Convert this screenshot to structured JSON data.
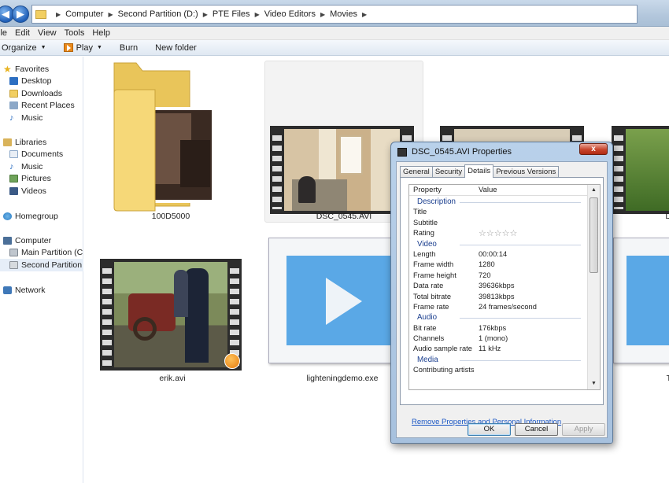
{
  "address": {
    "crumbs": [
      "Computer",
      "Second Partition (D:)",
      "PTE Files",
      "Video Editors",
      "Movies"
    ]
  },
  "menu": [
    "ile",
    "Edit",
    "View",
    "Tools",
    "Help"
  ],
  "toolbar": {
    "organize": "Organize",
    "play": "Play",
    "burn": "Burn",
    "new_folder": "New folder"
  },
  "sidebar": {
    "favorites": "Favorites",
    "fav_items": [
      "Desktop",
      "Downloads",
      "Recent Places",
      "Music"
    ],
    "libraries": "Libraries",
    "lib_items": [
      "Documents",
      "Music",
      "Pictures",
      "Videos"
    ],
    "homegroup": "Homegroup",
    "computer": "Computer",
    "comp_items": [
      "Main Partition (C:)",
      "Second Partition (D:)"
    ],
    "network": "Network"
  },
  "files": [
    {
      "name": "100D5000",
      "kind": "folder"
    },
    {
      "name": "DSC_0545.AVI",
      "kind": "video",
      "selected": true
    },
    {
      "name": "erik.avi",
      "kind": "video"
    },
    {
      "name": "lighteningdemo.exe",
      "kind": "exe"
    },
    {
      "name": "D",
      "kind": "video"
    },
    {
      "name": "T",
      "kind": "exe"
    }
  ],
  "dialog": {
    "title": "DSC_0545.AVI Properties",
    "close": "x",
    "tabs": [
      "General",
      "Security",
      "Details",
      "Previous Versions"
    ],
    "active_tab": "Details",
    "col_property": "Property",
    "col_value": "Value",
    "rows": [
      {
        "type": "section",
        "k": "Description"
      },
      {
        "type": "prop",
        "k": "Title",
        "v": ""
      },
      {
        "type": "prop",
        "k": "Subtitle",
        "v": ""
      },
      {
        "type": "rating",
        "k": "Rating",
        "v": "☆☆☆☆☆"
      },
      {
        "type": "section",
        "k": "Video"
      },
      {
        "type": "prop",
        "k": "Length",
        "v": "00:00:14"
      },
      {
        "type": "prop",
        "k": "Frame width",
        "v": "1280"
      },
      {
        "type": "prop",
        "k": "Frame height",
        "v": "720"
      },
      {
        "type": "prop",
        "k": "Data rate",
        "v": "39636kbps"
      },
      {
        "type": "prop",
        "k": "Total bitrate",
        "v": "39813kbps"
      },
      {
        "type": "prop",
        "k": "Frame rate",
        "v": "24 frames/second"
      },
      {
        "type": "section",
        "k": "Audio"
      },
      {
        "type": "prop",
        "k": "Bit rate",
        "v": "176kbps"
      },
      {
        "type": "prop",
        "k": "Channels",
        "v": "1 (mono)"
      },
      {
        "type": "prop",
        "k": "Audio sample rate",
        "v": "11 kHz"
      },
      {
        "type": "section",
        "k": "Media"
      },
      {
        "type": "prop",
        "k": "Contributing artists",
        "v": ""
      }
    ],
    "remove_link": "Remove Properties and Personal Information",
    "ok": "OK",
    "cancel": "Cancel",
    "apply": "Apply"
  },
  "colors": {
    "accent_blue": "#1a56c4",
    "folder_yellow": "#f2cf62",
    "close_red": "#c7452c"
  }
}
